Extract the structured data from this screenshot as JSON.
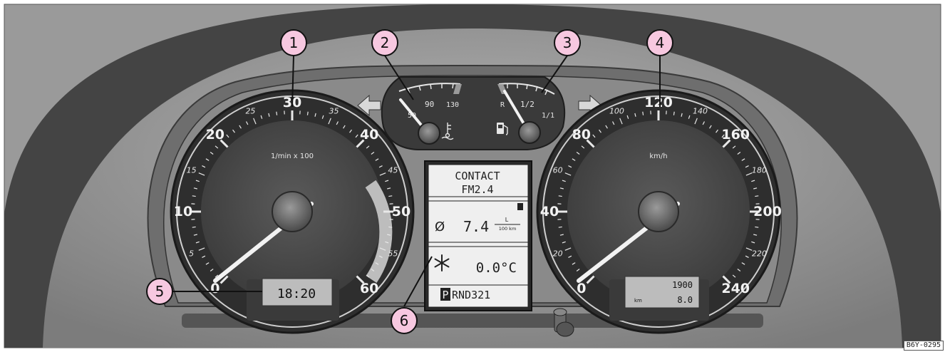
{
  "tachometer": {
    "unit": "1/min x 100",
    "major_ticks": [
      "0",
      "10",
      "20",
      "30",
      "40",
      "50",
      "60"
    ],
    "minor_ticks": [
      "5",
      "15",
      "25",
      "35",
      "45",
      "55"
    ],
    "clock_display": "18:20"
  },
  "speedometer": {
    "unit": "km/h",
    "major_ticks": [
      "0",
      "40",
      "80",
      "120",
      "160",
      "200",
      "240"
    ],
    "minor_ticks": [
      "20",
      "60",
      "100",
      "140",
      "180",
      "220"
    ],
    "odometer_total": "1900",
    "odometer_unit": "km",
    "odometer_trip": "8.0"
  },
  "coolant_gauge": {
    "labels": [
      "50",
      "90",
      "130"
    ]
  },
  "fuel_gauge": {
    "labels": [
      "R",
      "1/2",
      "1/1"
    ]
  },
  "display": {
    "line1": "CONTACT",
    "line2": "FM2.4",
    "consumption_symbol": "Ø",
    "consumption_value": "7.4",
    "consumption_unit_top": "L",
    "consumption_unit_bottom": "100 km",
    "outside_temp": "0.0°C",
    "gear_selected": "P",
    "gear_rest": "RND321"
  },
  "callouts": [
    "1",
    "2",
    "3",
    "4",
    "5",
    "6"
  ],
  "reference": "B6Y-0295"
}
